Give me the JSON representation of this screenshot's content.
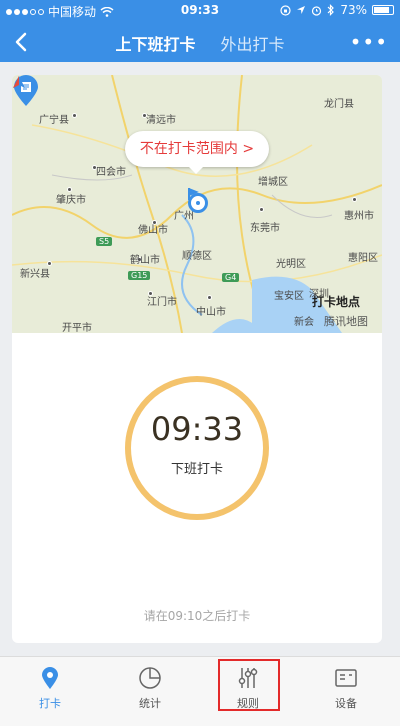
{
  "status_bar": {
    "carrier": "中国移动",
    "time": "09:33",
    "battery": "73%"
  },
  "nav": {
    "tabs": [
      {
        "label": "上下班打卡"
      },
      {
        "label": "外出打卡"
      }
    ],
    "more": "•••"
  },
  "map": {
    "warning": "不在打卡范围内 >",
    "checkin_label": "打卡地点",
    "brand": "腾讯地图",
    "place_labels": [
      "广宁县",
      "清远市",
      "龙门县",
      "四会市",
      "增城区",
      "肇庆市",
      "佛山市",
      "广州",
      "东莞市",
      "惠州市",
      "鹤山市",
      "顺德区",
      "光明区",
      "惠阳区",
      "新兴县",
      "江门市",
      "中山市",
      "宝安区",
      "深圳",
      "开平市",
      "新会"
    ],
    "highways": [
      "S5",
      "G15",
      "G4"
    ]
  },
  "clock": {
    "time": "09:33",
    "label": "下班打卡"
  },
  "hint": "请在09:10之后打卡",
  "bottom_nav": [
    {
      "label": "打卡",
      "icon": "map-pin-icon",
      "active": true
    },
    {
      "label": "统计",
      "icon": "pie-chart-icon"
    },
    {
      "label": "规则",
      "icon": "sliders-icon",
      "highlighted": true
    },
    {
      "label": "设备",
      "icon": "device-icon"
    }
  ],
  "colors": {
    "primary": "#3a8fe6",
    "warning": "#e53b3b",
    "ring": "#f4c36c",
    "highlight": "#e32a2a"
  }
}
